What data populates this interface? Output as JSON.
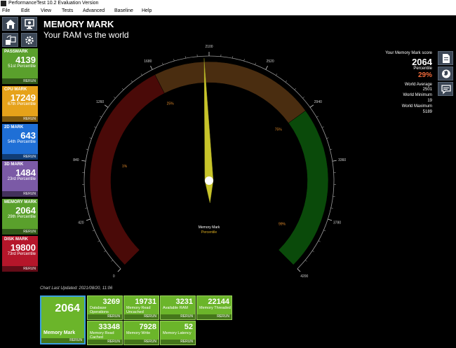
{
  "window": {
    "title": "PerformanceTest 10.2 Evaluation Version"
  },
  "menu": [
    "File",
    "Edit",
    "View",
    "Tests",
    "Advanced",
    "Baseline",
    "Help"
  ],
  "nav_icons": [
    "home-icon",
    "system-info-icon",
    "compare-icon",
    "settings-icon"
  ],
  "tiles": [
    {
      "name": "PASSMARK",
      "value": "4139",
      "percentile": "51st Percentile",
      "rerun": "RERUN",
      "color": "#5aa02c",
      "icon": "passmark-icon"
    },
    {
      "name": "CPU MARK",
      "value": "17249",
      "percentile": "67th Percentile",
      "rerun": "RERUN",
      "color": "#e6a21a",
      "icon": "cpu-icon"
    },
    {
      "name": "2D MARK",
      "value": "643",
      "percentile": "54th Percentile",
      "rerun": "RERUN",
      "color": "#1f6fd6",
      "icon": "2d-icon"
    },
    {
      "name": "3D MARK",
      "value": "1484",
      "percentile": "23rd Percentile",
      "rerun": "RERUN",
      "color": "#7b5aa6",
      "icon": "3d-icon"
    },
    {
      "name": "MEMORY MARK",
      "value": "2064",
      "percentile": "29th Percentile",
      "rerun": "RERUN",
      "color": "#5aa02c",
      "icon": "memory-icon"
    },
    {
      "name": "DISK MARK",
      "value": "19800",
      "percentile": "73rd Percentile",
      "rerun": "RERUN",
      "color": "#b5162a",
      "icon": "disk-icon"
    }
  ],
  "header": {
    "title": "MEMORY MARK",
    "subtitle": "Your RAM vs the world"
  },
  "score": {
    "label": "Your Memory Mark score",
    "value": "2064",
    "percentile_label": "Percentile",
    "percentile": "29%",
    "avg_label": "World Average",
    "avg": "2501",
    "min_label": "World Minimum",
    "min": "19",
    "max_label": "World Maximum",
    "max": "5189"
  },
  "side_icons": [
    "report-icon",
    "globe-icon",
    "comment-icon"
  ],
  "chart_data": {
    "type": "gauge",
    "min": 0,
    "max": 4200,
    "value": 2064,
    "ticks": [
      "0",
      "420",
      "840",
      "1260",
      "1680",
      "2100",
      "2520",
      "2940",
      "3360",
      "3780",
      "4200"
    ],
    "bands": [
      {
        "from": 0,
        "to": 1680,
        "color": "#4a0a08",
        "label": "1%"
      },
      {
        "from": 1680,
        "to": 2940,
        "color": "#4a2d10",
        "label": "25%"
      },
      {
        "from": 2940,
        "to": 4200,
        "color": "#0a4a0a",
        "label": "75%"
      }
    ],
    "end_label": "99%",
    "center_title": "Memory Mark",
    "center_subtitle": "Percentile"
  },
  "updated": "Chart Last Updated: 2021/08/20, 11:06",
  "memory_tile": {
    "value": "2064",
    "label": "Memory Mark",
    "rerun": "RERUN"
  },
  "subtests": [
    {
      "value": "3269",
      "label": "Database Operations",
      "rerun": "RERUN"
    },
    {
      "value": "19731",
      "label": "Memory Read Uncached",
      "rerun": "RERUN"
    },
    {
      "value": "3231",
      "label": "Available RAM",
      "rerun": "RERUN"
    },
    {
      "value": "22144",
      "label": "Memory Threaded",
      "rerun": "RERUN"
    },
    {
      "value": "33348",
      "label": "Memory Read Cached",
      "rerun": "RERUN"
    },
    {
      "value": "7928",
      "label": "Memory Write",
      "rerun": "RERUN"
    },
    {
      "value": "52",
      "label": "Memory Latency",
      "rerun": "RERUN"
    }
  ]
}
